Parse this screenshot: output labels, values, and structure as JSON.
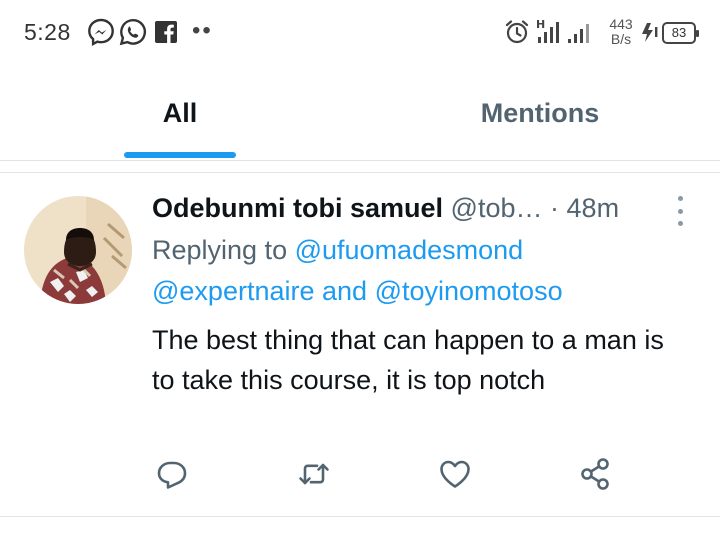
{
  "status_bar": {
    "time": "5:28",
    "network_speed_value": "443",
    "network_speed_unit": "B/s",
    "signal_type": "H",
    "battery": "83",
    "icons": [
      "messenger-icon",
      "whatsapp-icon",
      "facebook-icon",
      "more-notifications-icon",
      "alarm-icon",
      "signal-icon",
      "charging-icon",
      "battery-icon"
    ]
  },
  "tabs": [
    {
      "label": "All",
      "selected": true
    },
    {
      "label": "Mentions",
      "selected": false
    }
  ],
  "accent_color": "#1d9bf0",
  "tweet": {
    "author": "Odebunmi tobi samuel",
    "handle": "@tob…",
    "separator": "·",
    "time": "48m",
    "replying_prefix": "Replying to",
    "replying_handle_1": "@ufuomadesmond",
    "replying_handle_2": "@expertnaire",
    "replying_conjunction": "and",
    "replying_handle_3": "@toyinomotoso",
    "text": "The best thing that can happen to a man is to take this course, it is top notch",
    "actions": [
      "reply-icon",
      "retweet-icon",
      "like-icon",
      "share-icon"
    ]
  }
}
